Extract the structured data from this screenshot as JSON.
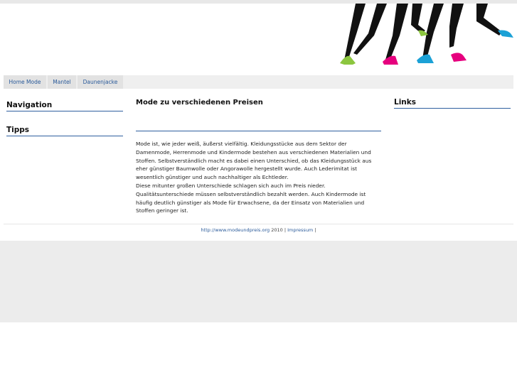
{
  "nav": {
    "items": [
      {
        "label": "Home Mode"
      },
      {
        "label": "Mantel"
      },
      {
        "label": "Daunenjacke"
      }
    ]
  },
  "sidebar_left": {
    "navigation_title": "Navigation",
    "tipps_title": "Tipps"
  },
  "main": {
    "title": "Mode zu verschiedenen Preisen",
    "paragraph_1": "Mode ist, wie jeder weiß, äußerst vielfältig. Kleidungsstücke aus dem Sektor der Damenmode, Herrenmode und Kindermode bestehen aus verschiedenen Materialien und Stoffen. Selbstverständlich macht es dabei einen Unterschied, ob das Kleidungsstück aus eher günstiger Baumwolle oder Angorawolle hergestellt wurde. Auch Lederimitat ist wesentlich günstiger und auch nachhaltiger als Echtleder.",
    "paragraph_2": "Diese mitunter großen Unterschiede schlagen sich auch im Preis nieder. Qualitätsunterschiede müssen selbstverständlich bezahlt werden. Auch Kindermode ist häufig deutlich günstiger als Mode für Erwachsene, da der Einsatz von Materialien und Stoffen geringer ist."
  },
  "sidebar_right": {
    "links_title": "Links"
  },
  "footer": {
    "site_link": "http://www.modeundpreis.org",
    "year": "2010",
    "sep1": "|",
    "impressum": "Impressum",
    "sep2": "|"
  },
  "header": {
    "image": "legs-high-heels-illustration",
    "shoe_colors": [
      "#8cc63f",
      "#e6007e",
      "#1ba1d6",
      "#e6007e",
      "#1ba1d6"
    ]
  }
}
